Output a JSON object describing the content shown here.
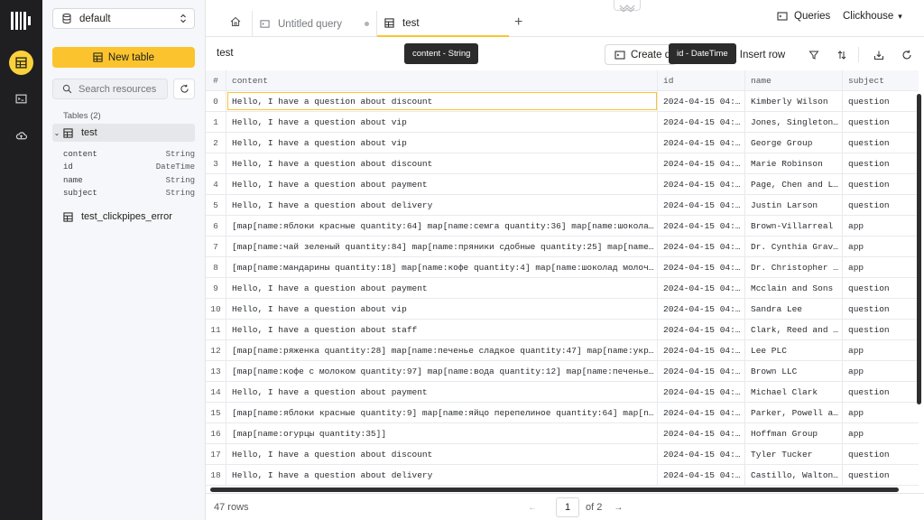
{
  "sidebar": {
    "database": "default",
    "new_table_label": "New table",
    "search_placeholder": "Search resources",
    "tables_label": "Tables (2)",
    "tables": [
      {
        "name": "test",
        "expanded": true,
        "columns": [
          {
            "name": "content",
            "type": "String"
          },
          {
            "name": "id",
            "type": "DateTime"
          },
          {
            "name": "name",
            "type": "String"
          },
          {
            "name": "subject",
            "type": "String"
          }
        ]
      },
      {
        "name": "test_clickpipes_error",
        "expanded": false
      }
    ]
  },
  "tabs": [
    {
      "label": "Untitled query",
      "icon": "query-icon",
      "active": false
    },
    {
      "label": "test",
      "icon": "table-icon",
      "active": true
    }
  ],
  "header": {
    "queries_label": "Queries",
    "service_label": "Clickhouse"
  },
  "toolbar": {
    "title": "test",
    "create_label": "Create query",
    "insert_label": "Insert row"
  },
  "tooltips": {
    "content": "content - String",
    "id": "id - DateTime"
  },
  "grid": {
    "columns": [
      "#",
      "content",
      "id",
      "name",
      "subject"
    ],
    "rows": [
      [
        "0",
        "Hello, I have a question about discount",
        "2024-04-15 04:…",
        "Kimberly Wilson",
        "question"
      ],
      [
        "1",
        "Hello, I have a question about vip",
        "2024-04-15 04:…",
        "Jones, Singleton…",
        "question"
      ],
      [
        "2",
        "Hello, I have a question about vip",
        "2024-04-15 04:…",
        "George Group",
        "question"
      ],
      [
        "3",
        "Hello, I have a question about discount",
        "2024-04-15 04:…",
        "Marie Robinson",
        "question"
      ],
      [
        "4",
        "Hello, I have a question about payment",
        "2024-04-15 04:…",
        "Page, Chen and L…",
        "question"
      ],
      [
        "5",
        "Hello, I have a question about delivery",
        "2024-04-15 04:…",
        "Justin Larson",
        "question"
      ],
      [
        "6",
        "[map[name:яблоки красные quantity:64] map[name:семга quantity:36] map[name:шоколад…",
        "2024-04-15 04:…",
        "Brown-Villarreal",
        "app"
      ],
      [
        "7",
        "[map[name:чай зеленый quantity:84] map[name:пряники сдобные quantity:25] map[name:…",
        "2024-04-15 04:…",
        "Dr. Cynthia Grav…",
        "app"
      ],
      [
        "8",
        "[map[name:мандарины quantity:18] map[name:кофе quantity:4] map[name:шоколад молоч…",
        "2024-04-15 04:…",
        "Dr. Christopher …",
        "app"
      ],
      [
        "9",
        "Hello, I have a question about payment",
        "2024-04-15 04:…",
        "Mcclain and Sons",
        "question"
      ],
      [
        "10",
        "Hello, I have a question about vip",
        "2024-04-15 04:…",
        "Sandra Lee",
        "question"
      ],
      [
        "11",
        "Hello, I have a question about staff",
        "2024-04-15 04:…",
        "Clark, Reed and …",
        "question"
      ],
      [
        "12",
        "[map[name:ряженка quantity:28] map[name:печенье сладкое quantity:47] map[name:укро…",
        "2024-04-15 04:…",
        "Lee PLC",
        "app"
      ],
      [
        "13",
        "[map[name:кофе с молоком quantity:97] map[name:вода quantity:12] map[name:печенье …",
        "2024-04-15 04:…",
        "Brown LLC",
        "app"
      ],
      [
        "14",
        "Hello, I have a question about payment",
        "2024-04-15 04:…",
        "Michael Clark",
        "question"
      ],
      [
        "15",
        "[map[name:яблоки красные quantity:9] map[name:яйцо перепелиное quantity:64] map[n…",
        "2024-04-15 04:…",
        "Parker, Powell a…",
        "app"
      ],
      [
        "16",
        "[map[name:огурцы quantity:35]]",
        "2024-04-15 04:…",
        "Hoffman Group",
        "app"
      ],
      [
        "17",
        "Hello, I have a question about discount",
        "2024-04-15 04:…",
        "Tyler Tucker",
        "question"
      ],
      [
        "18",
        "Hello, I have a question about delivery",
        "2024-04-15 04:…",
        "Castillo, Walton…",
        "question"
      ]
    ]
  },
  "footer": {
    "row_count": "47 rows",
    "current_page": "1",
    "of_pages": "of 2"
  },
  "colors": {
    "accent": "#fbc42e",
    "rail": "#1f1f22"
  }
}
